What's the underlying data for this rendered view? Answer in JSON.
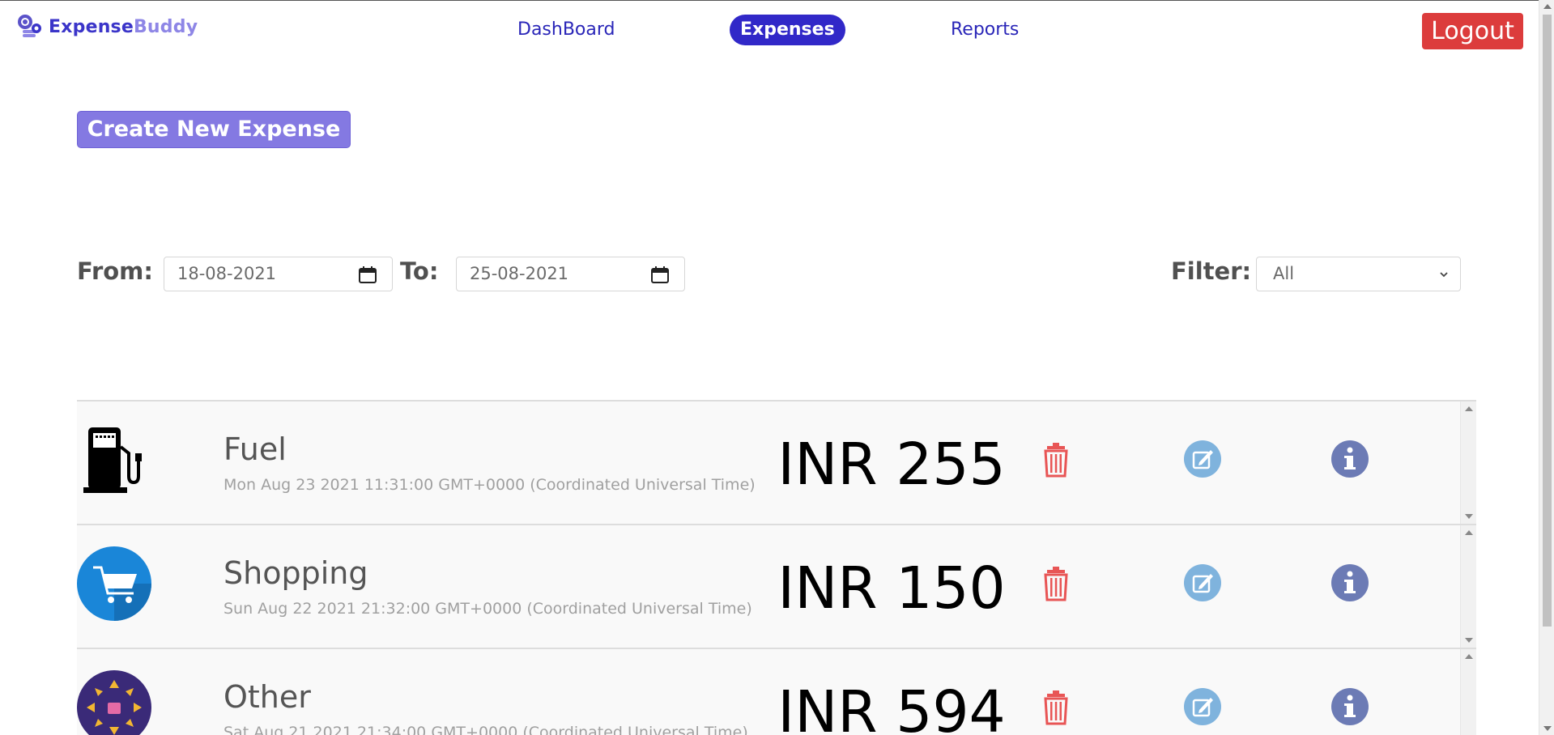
{
  "brand": {
    "name_part1": "Expense",
    "name_part2": "Buddy",
    "icon": "coins-gear-icon"
  },
  "nav": {
    "items": [
      {
        "label": "DashBoard",
        "active": false
      },
      {
        "label": "Expenses",
        "active": true
      },
      {
        "label": "Reports",
        "active": false
      }
    ],
    "logout_label": "Logout"
  },
  "actions": {
    "create_label": "Create New Expense"
  },
  "filters": {
    "from_label": "From:",
    "from_value": "18-08-2021",
    "to_label": "To:",
    "to_value": "25-08-2021",
    "filter_label": "Filter:",
    "filter_value": "All"
  },
  "expenses": [
    {
      "category": "Fuel",
      "date": "Mon Aug 23 2021 11:31:00 GMT+0000 (Coordinated Universal Time)",
      "amount": "INR 255",
      "icon": "fuel-pump-icon"
    },
    {
      "category": "Shopping",
      "date": "Sun Aug 22 2021 21:32:00 GMT+0000 (Coordinated Universal Time)",
      "amount": "INR 150",
      "icon": "shopping-cart-icon"
    },
    {
      "category": "Other",
      "date": "Sat Aug 21 2021 21:34:00 GMT+0000 (Coordinated Universal Time)",
      "amount": "INR 594",
      "icon": "other-category-icon"
    }
  ],
  "colors": {
    "primary": "#3128c8",
    "create_button": "#8479e2",
    "logout": "#dc3c3c",
    "delete_icon": "#e85555",
    "edit_icon": "#7fb3dd",
    "info_icon": "#6c7bb5"
  }
}
